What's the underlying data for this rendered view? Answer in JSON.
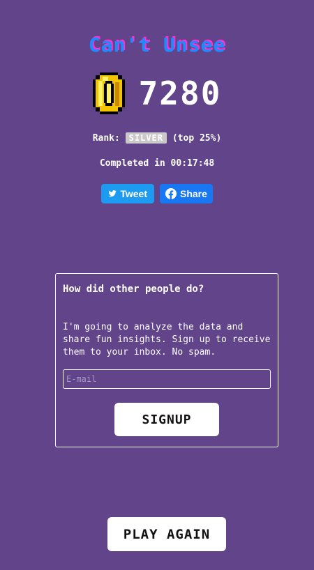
{
  "header": {
    "title": "Can't Unsee"
  },
  "score": {
    "value": "7280",
    "icon": "coin-icon"
  },
  "rank": {
    "label": "Rank:",
    "badge": "SILVER",
    "suffix": "(top 25%)"
  },
  "completed": {
    "text": "Completed in 00:17:48"
  },
  "share": {
    "tweet_label": "Tweet",
    "share_label": "Share"
  },
  "signup_card": {
    "title": "How did other people do?",
    "description": "I'm going to analyze the data and share fun insights. Sign up to receive them to your inbox. No spam.",
    "email_placeholder": "E-mail",
    "email_value": "",
    "signup_label": "SIGNUP"
  },
  "actions": {
    "play_again_label": "PLAY AGAIN"
  },
  "colors": {
    "background": "#61448a",
    "title_blue": "#1a8cff",
    "title_pink": "#ff2fd0",
    "twitter": "#1d9bf0",
    "facebook": "#1877f2",
    "badge": "#c9c9c9"
  }
}
